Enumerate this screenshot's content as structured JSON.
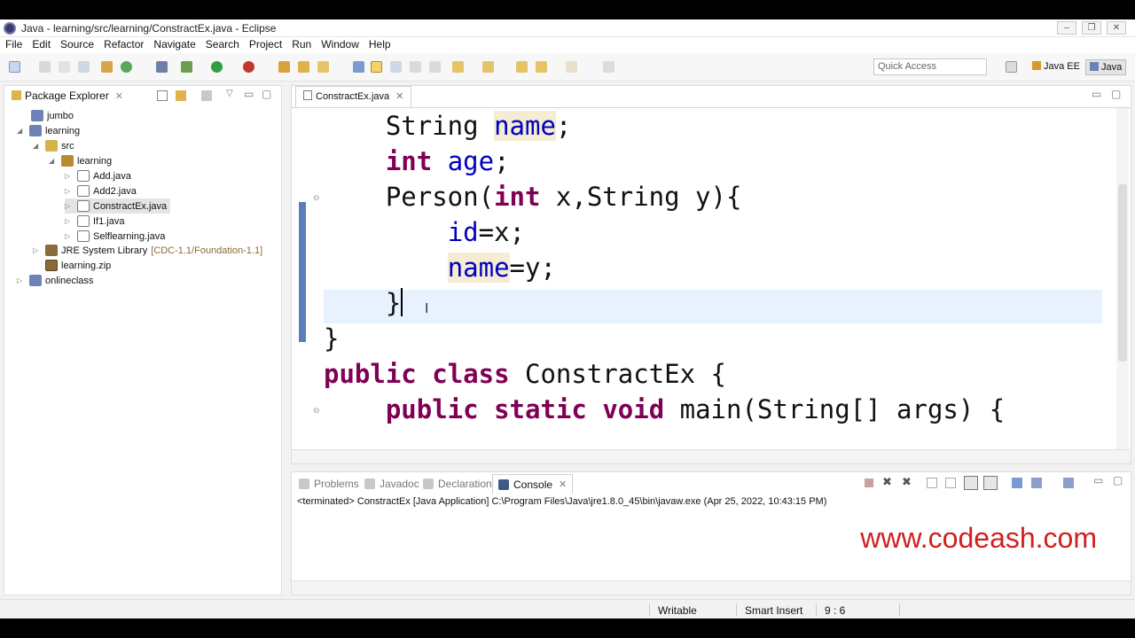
{
  "window": {
    "title": "Java - learning/src/learning/ConstractEx.java - Eclipse"
  },
  "menu": [
    "File",
    "Edit",
    "Source",
    "Refactor",
    "Navigate",
    "Search",
    "Project",
    "Run",
    "Window",
    "Help"
  ],
  "toolbar": {
    "quick_access_placeholder": "Quick Access",
    "perspectives": [
      "Java EE",
      "Java"
    ]
  },
  "package_explorer": {
    "title": "Package Explorer",
    "items": [
      {
        "label": "jumbo",
        "icon": "project-icon"
      },
      {
        "label": "learning",
        "icon": "project-icon"
      },
      {
        "label": "src",
        "icon": "source-folder-icon"
      },
      {
        "label": "learning",
        "icon": "package-icon"
      },
      {
        "label": "Add.java",
        "icon": "java-file-icon"
      },
      {
        "label": "Add2.java",
        "icon": "java-file-icon"
      },
      {
        "label": "ConstractEx.java",
        "icon": "java-file-icon"
      },
      {
        "label": "If1.java",
        "icon": "java-file-icon"
      },
      {
        "label": "Selflearning.java",
        "icon": "java-file-icon"
      },
      {
        "label": "JRE System Library",
        "decoration": "[CDC-1.1/Foundation-1.1]",
        "icon": "library-icon"
      },
      {
        "label": "learning.zip",
        "icon": "zip-icon"
      },
      {
        "label": "onlineclass",
        "icon": "project-icon"
      }
    ]
  },
  "editor": {
    "tab_label": "ConstractEx.java",
    "cursor_position": "9 : 6"
  },
  "console": {
    "tabs": [
      "Problems",
      "Javadoc",
      "Declaration",
      "Console"
    ],
    "active_tab": "Console",
    "status_line": "<terminated> ConstractEx [Java Application] C:\\Program Files\\Java\\jre1.8.0_45\\bin\\javaw.exe (Apr 25, 2022, 10:43:15 PM)",
    "watermark": "www.codeash.com"
  },
  "statusbar": {
    "mode": "Writable",
    "insert_mode": "Smart Insert",
    "position": "9 : 6"
  },
  "colors": {
    "keyword": "#7f0055",
    "field": "#0000c0",
    "watermark": "#d11f1f",
    "current_line": "#e8f2fe"
  }
}
